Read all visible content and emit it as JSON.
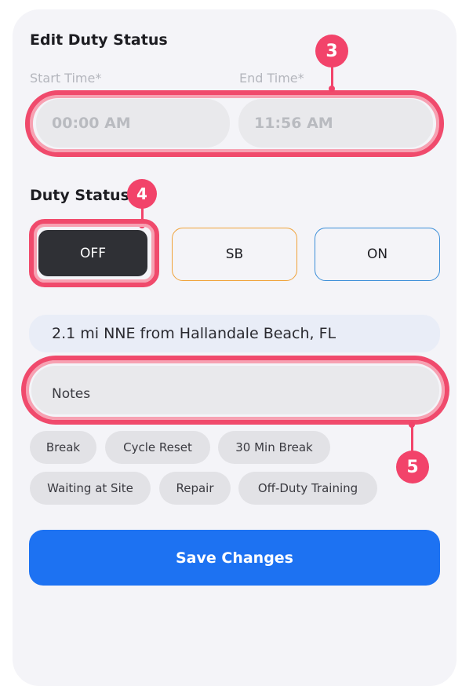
{
  "form": {
    "title": "Edit Duty Status",
    "start_time": {
      "label": "Start Time*",
      "value": "00:00 AM"
    },
    "end_time": {
      "label": "End Time*",
      "value": "11:56 AM"
    },
    "duty_status_label": "Duty Status",
    "duty_options": [
      {
        "label": "OFF",
        "selected": true,
        "color": "#2f3035"
      },
      {
        "label": "SB",
        "selected": false,
        "color": "#f0a238"
      },
      {
        "label": "ON",
        "selected": false,
        "color": "#3b8ed8"
      }
    ],
    "location": "2.1 mi NNE from Hallandale Beach, FL",
    "notes_placeholder": "Notes",
    "quick_notes": [
      "Break",
      "Cycle Reset",
      "30 Min Break",
      "Waiting at Site",
      "Repair",
      "Off-Duty Training"
    ],
    "save_label": "Save Changes"
  },
  "annotations": {
    "time_badge": "3",
    "duty_badge": "4",
    "notes_badge": "5",
    "highlight_color": "#f2436a"
  }
}
